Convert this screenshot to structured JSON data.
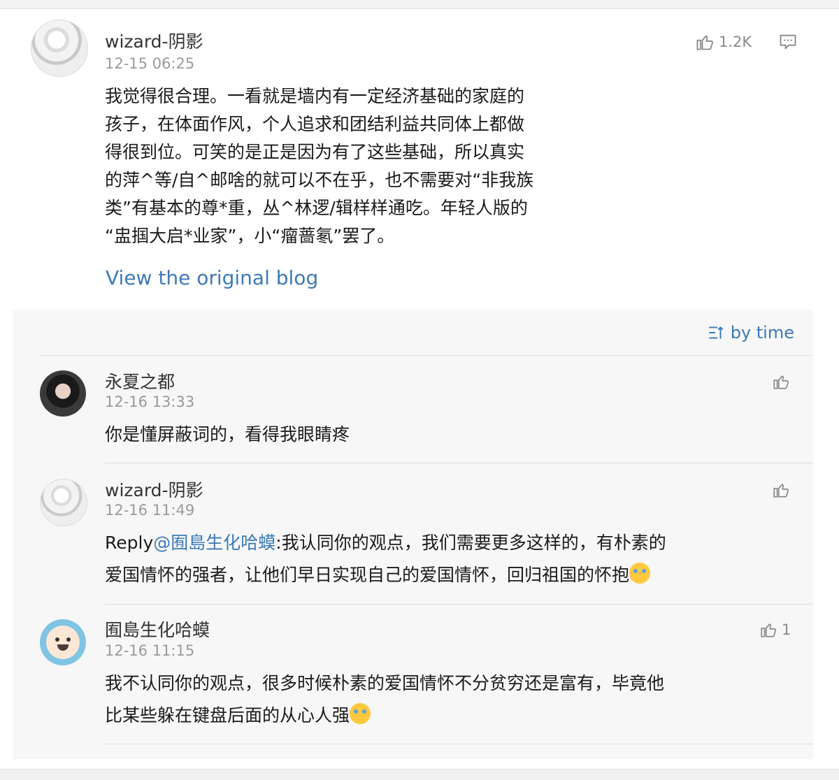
{
  "post": {
    "author": "wizard-阴影",
    "timestamp": "12-15 06:25",
    "likes": "1.2K",
    "body_lines": [
      "我觉得很合理。一看就是墙内有一定经济基础的家庭的",
      "孩子，在体面作风，个人追求和团结利益共同体上都做",
      "得很到位。可笑的是正是因为有了这些基础，所以真实",
      "的萍^等/自^邮啥的就可以不在乎，也不需要对“非我族",
      "类”有基本的尊*重，丛^林逻/辑样样通吃。年轻人版的",
      "“盅掴大启*业家”，小“瘤蔷氡”罢了。"
    ],
    "view_original": "View the original blog"
  },
  "sort": {
    "label": "by time"
  },
  "comments": [
    {
      "author": "永夏之都",
      "timestamp": "12-16 13:33",
      "lines": [
        "你是懂屏蔽词的，看得我眼睛疼"
      ],
      "likes": ""
    },
    {
      "author": "wizard-阴影",
      "timestamp": "12-16 11:49",
      "reply_prefix": "Reply",
      "reply_to": "@囿島生化哈蟆",
      "line1_rest": ":我认同你的观点，我们需要更多这样的，有朴素的",
      "line2": "爱国情怀的强者，让他们早日实现自己的爱国情怀，回归祖国的怀抱",
      "likes": ""
    },
    {
      "author": "囿島生化哈蟆",
      "timestamp": "12-16 11:15",
      "lines": [
        "我不认同你的观点，很多时候朴素的爱国情怀不分贫穷还是富有，毕竟他",
        "比某些躲在键盘后面的从心人强"
      ],
      "likes": "1"
    }
  ],
  "icons": {
    "like": "thumbs-up-icon",
    "comment": "comment-bubble-icon",
    "sort": "sort-lines-icon",
    "emoji": "crying-laughing-emoji"
  },
  "colors": {
    "link": "#3d7ab8",
    "timestamp": "#9a9a9a",
    "panel": "#f7f7f7"
  }
}
